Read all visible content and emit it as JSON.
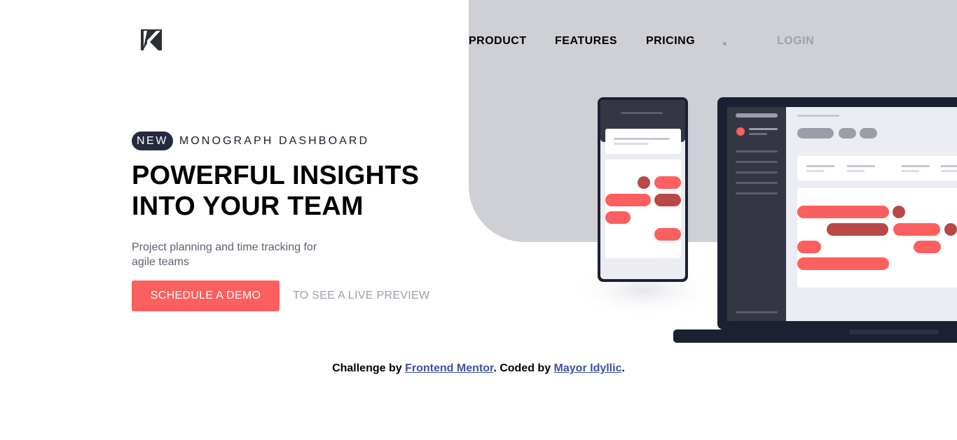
{
  "brand": {
    "logo_icon": "k-monogram-logo-icon"
  },
  "nav": {
    "items": [
      {
        "label": "PRODUCT"
      },
      {
        "label": "FEATURES"
      },
      {
        "label": "PRICING"
      }
    ],
    "login_label": "LOGIN"
  },
  "hero": {
    "badge": "NEW",
    "eyebrow": "MONOGRAPH DASHBOARD",
    "headline": "POWERFUL INSIGHTS\nINTO YOUR TEAM",
    "subtext": "Project planning and time tracking for\nagile teams",
    "cta_label": "SCHEDULE A DEMO",
    "preview_label": "TO SEE A LIVE PREVIEW"
  },
  "footer": {
    "prefix": "Challenge by ",
    "link1": "Frontend Mentor",
    "middle": ". Coded by ",
    "link2": "Mayor Idyllic",
    "suffix": "."
  },
  "colors": {
    "accent": "#fb5f5f",
    "accent_dark": "#b94848",
    "navy": "#252a3e",
    "panel": "#cfd0d5",
    "muted": "#9aa0ab"
  }
}
